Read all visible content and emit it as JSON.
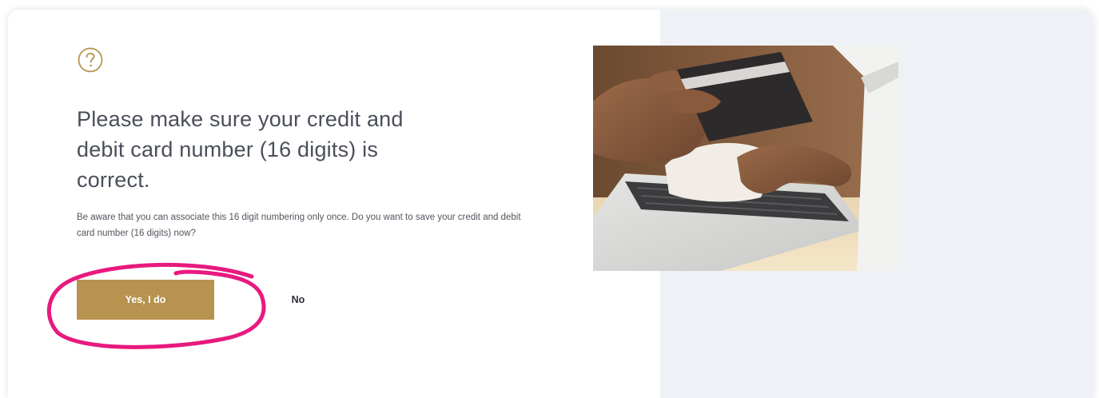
{
  "dialog": {
    "icon": "question-circle-icon",
    "title": "Please make sure your credit and debit card number (16 digits) is correct.",
    "description": "Be aware that you can associate this 16 digit numbering only once. Do you want to save your credit and debit card number (16 digits) now?",
    "confirm_label": "Yes, I do",
    "cancel_label": "No",
    "image": "credit-card-laptop-photo"
  },
  "colors": {
    "accent": "#b8924f",
    "panel_bg": "#eef1f5",
    "title_text": "#4a4f5a",
    "annotation": "#e8197f"
  }
}
